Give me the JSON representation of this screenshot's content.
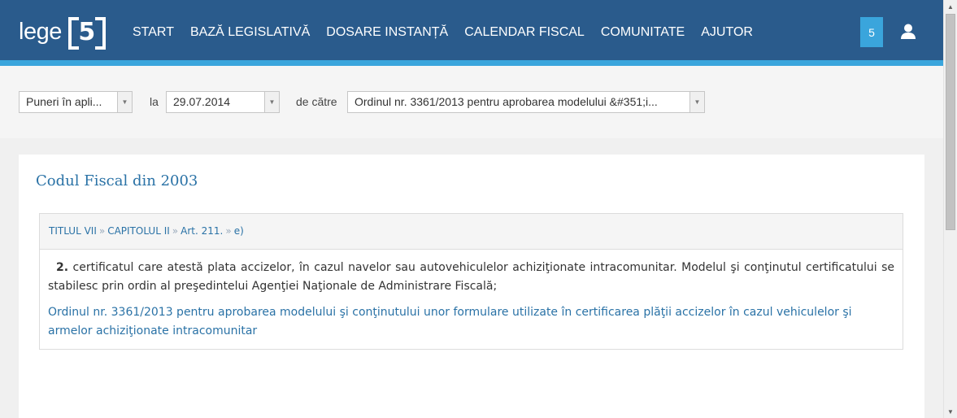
{
  "header": {
    "logo_text": "lege",
    "logo_number": "5",
    "nav": [
      "START",
      "BAZĂ LEGISLATIVĂ",
      "DOSARE INSTANȚĂ",
      "CALENDAR FISCAL",
      "COMUNITATE",
      "AJUTOR"
    ],
    "badge": "5",
    "user_icon": "user-icon"
  },
  "filters": {
    "type_select": "Puneri în apli...",
    "la_label": "la",
    "date_select": "29.07.2014",
    "de_catre_label": "de către",
    "act_select": "Ordinul nr. 3361/2013 pentru aprobarea modelului &#351;i..."
  },
  "document": {
    "title": "Codul Fiscal din 2003",
    "breadcrumb": [
      "TITLUL VII",
      "CAPITOLUL II",
      "Art. 211.",
      "e)"
    ],
    "paragraph_number": "2.",
    "paragraph_text": " certificatul care atestă plata accizelor, în cazul navelor sau autovehiculelor achiziţionate intracomunitar. Modelul şi conţinutul certificatului se stabilesc prin ordin al preşedintelui Agenţiei Naţionale de Administrare Fiscală;",
    "order_link": "Ordinul nr. 3361/2013 pentru aprobarea modelului şi conţinutului unor formulare utilizate în certificarea plăţii accizelor în cazul vehiculelor şi armelor achiziţionate intracomunitar"
  },
  "colors": {
    "header_bg": "#2a5b8c",
    "accent": "#3aa5dc",
    "link": "#2a72a6"
  }
}
